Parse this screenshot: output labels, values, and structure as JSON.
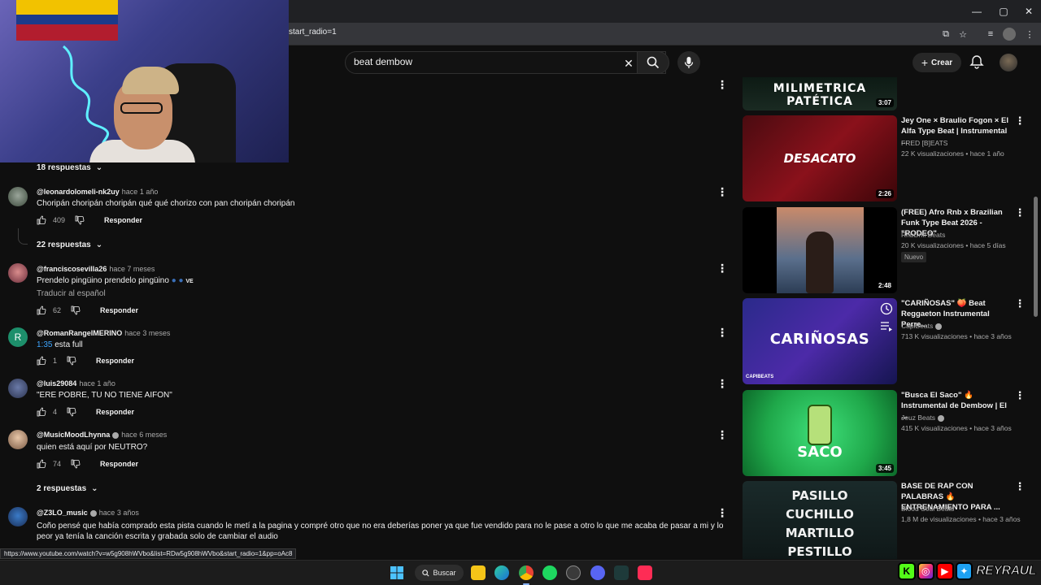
{
  "browser": {
    "url_fragment": "start_radio=1",
    "status_url": "https://www.youtube.com/watch?v=w5g908hWVbo&list=RDw5g908hWVbo&start_radio=1&pp=oAc8"
  },
  "header": {
    "search_value": "beat dembow",
    "create_label": "Crear"
  },
  "comments": [
    {
      "replies_label": "18 respuestas"
    },
    {
      "author": "@leonardolomeli-nk2uy",
      "time": "hace 1 año",
      "text": "Choripán choripán choripán qué qué chorizo con pan choripán choripán",
      "likes": "409",
      "reply_label": "Responder",
      "replies_label": "22 respuestas"
    },
    {
      "author": "@franciscosevilla26",
      "time": "hace 7 meses",
      "text": "Prendelo pingüino prendelo pingüino",
      "emoji_suffix": "VE",
      "translate": "Traducir al español",
      "likes": "62",
      "reply_label": "Responder"
    },
    {
      "author": "@RomanRangelMERINO",
      "time": "hace 3 meses",
      "timestamp_link": "1:35",
      "text": " esta full",
      "likes": "1",
      "reply_label": "Responder",
      "avatar_letter": "R"
    },
    {
      "author": "@luis29084",
      "time": "hace 1 año",
      "text": "\"ERE POBRE, TU NO TIENE AIFON\"",
      "likes": "4",
      "reply_label": "Responder"
    },
    {
      "author": "@MusicMoodLhynna",
      "time": "hace 6 meses",
      "text": "quien está aquí por NEUTRO?",
      "likes": "74",
      "reply_label": "Responder",
      "replies_label": "2 respuestas"
    },
    {
      "author": "@Z3LO_music",
      "time": "hace 3 años",
      "text": "Coño pensé que había comprado esta pista cuando le metí a la pagina y compré otro que no era deberías poner ya que fue vendido para no le pase a otro lo que me acaba de pasar a mi y lo peor ya tenía la canción escrita y grabada solo de cambiar el audio"
    }
  ],
  "sidebar": {
    "videos": [
      {
        "thumb_text": "MILIMETRICA PATÉTICA",
        "duration": "3:07"
      },
      {
        "title": "Jey One × Braulio Fogon × El Alfa Type Beat | Instrumental ...",
        "channel": "FRED [B]EATS",
        "meta": "22 K visualizaciones • hace 1 año",
        "thumb_text": "DESACATO",
        "duration": "2:26"
      },
      {
        "title": "(FREE) Afro Rnb x Brazilian Funk Type Beat 2026 - \"RODEO\"",
        "channel": "RnbDrill Beats",
        "meta": "20 K visualizaciones • hace 5 días",
        "badge": "Nuevo",
        "duration": "2:48"
      },
      {
        "title": "\"CARIÑOSAS\" 🍑 Beat Reggaeton Instrumental Perre...",
        "channel": "CapiBeats",
        "meta": "713 K visualizaciones • hace 3 años",
        "thumb_text": "CARIÑOSAS",
        "thumb_sub": "CAPIBEATS"
      },
      {
        "title": "\"Busca El Saco\" 🔥 Instrumental de Dembow | El ...",
        "channel": "Jeuz Beats",
        "meta": "415 K visualizaciones • hace 3 años",
        "thumb_text": "SACO",
        "duration": "3:45"
      },
      {
        "title": "BASE DE RAP CON PALABRAS 🔥 ENTRENAMIENTO PARA ...",
        "channel": "Blood Soul Beats",
        "meta": "1,8 M de visualizaciones • hace 3 años",
        "thumb_lines": [
          "PASILLO",
          "CUCHILLO",
          "MARTILLO",
          "PESTILLO"
        ]
      }
    ]
  },
  "taskbar": {
    "search_label": "Buscar"
  },
  "overlay": {
    "brand_name": "REYRAUL"
  },
  "colors": {
    "background": "#0f0f0f",
    "accent_link": "#3ea6ff",
    "text_secondary": "#aaaaaa"
  }
}
